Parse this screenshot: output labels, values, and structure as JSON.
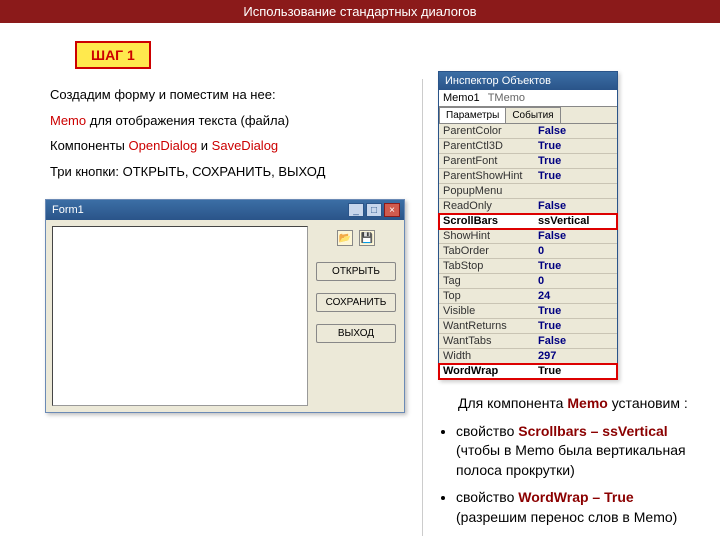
{
  "header": {
    "title": "Использование стандартных диалогов"
  },
  "step": {
    "label": "ШАГ 1"
  },
  "desc": {
    "l1a": "Создадим форму и поместим на нее:",
    "l2a": "Memo",
    "l2b": " для отображения текста (файла)",
    "l3a": "Компоненты ",
    "l3b": "OpenDialog",
    "l3c": " и ",
    "l3d": "SaveDialog",
    "l4a": "Три кнопки: ОТКРЫТЬ, СОХРАНИТЬ, ВЫХОД"
  },
  "form": {
    "title": "Form1",
    "btn_open": "ОТКРЫТЬ",
    "btn_save": "СОХРАНИТЬ",
    "btn_exit": "ВЫХОД"
  },
  "inspector": {
    "title": "Инспектор Объектов",
    "obj_name": "Memo1",
    "obj_class": "TMemo",
    "tab_props": "Параметры",
    "tab_events": "События",
    "rows": [
      {
        "k": "ParentColor",
        "v": "False"
      },
      {
        "k": "ParentCtl3D",
        "v": "True"
      },
      {
        "k": "ParentFont",
        "v": "True"
      },
      {
        "k": "ParentShowHint",
        "v": "True"
      },
      {
        "k": "PopupMenu",
        "v": ""
      },
      {
        "k": "ReadOnly",
        "v": "False"
      },
      {
        "k": "ScrollBars",
        "v": "ssVertical"
      },
      {
        "k": "ShowHint",
        "v": "False"
      },
      {
        "k": "TabOrder",
        "v": "0"
      },
      {
        "k": "TabStop",
        "v": "True"
      },
      {
        "k": "Tag",
        "v": "0"
      },
      {
        "k": "Top",
        "v": "24"
      },
      {
        "k": "Visible",
        "v": "True"
      },
      {
        "k": "WantReturns",
        "v": "True"
      },
      {
        "k": "WantTabs",
        "v": "False"
      },
      {
        "k": "Width",
        "v": "297"
      },
      {
        "k": "WordWrap",
        "v": "True"
      }
    ]
  },
  "explain": {
    "intro1": "Для компонента ",
    "intro2": "Memo",
    "intro3": " установим :",
    "b1a": "свойство ",
    "b1b": "Scrollbars – ssVertical",
    "b1c": " (чтобы в Memo была вертикальная полоса прокрутки)",
    "b2a": "свойство ",
    "b2b": "WordWrap – True",
    "b2c": " (разрешим перенос слов в Memo)"
  }
}
